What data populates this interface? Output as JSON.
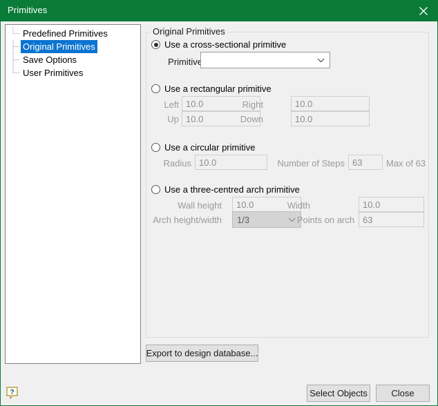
{
  "window": {
    "title": "Primitives",
    "titlebar_color": "#0a7b38",
    "close_icon": "close-icon"
  },
  "sidebar": {
    "items": [
      {
        "label": "Predefined Primitives",
        "selected": false
      },
      {
        "label": "Original Primitives",
        "selected": true
      },
      {
        "label": "Save Options",
        "selected": false
      },
      {
        "label": "User Primitives",
        "selected": false
      }
    ],
    "selection_color": "#0b74d1"
  },
  "main": {
    "group_title": "Original Primitives",
    "options": {
      "cross_sectional": {
        "label": "Use a cross-sectional primitive",
        "selected": true,
        "primitive_label": "Primitive",
        "primitive_value": "",
        "primitive_placeholder": "",
        "dropdown_icon": "chevron-down-icon"
      },
      "rectangular": {
        "label": "Use a rectangular primitive",
        "selected": false,
        "fields": [
          {
            "label": "Left",
            "value": "10.0"
          },
          {
            "label": "Right",
            "value": "10.0"
          },
          {
            "label": "Up",
            "value": "10.0"
          },
          {
            "label": "Down",
            "value": "10.0"
          }
        ]
      },
      "circular": {
        "label": "Use a circular primitive",
        "selected": false,
        "radius_label": "Radius",
        "radius_value": "10.0",
        "steps_label": "Number of Steps",
        "steps_value": "63",
        "steps_note": "Max of 63"
      },
      "arch": {
        "label": "Use a three-centred arch primitive",
        "selected": false,
        "wall_height_label": "Wall height",
        "wall_height_value": "10.0",
        "width_label": "Width",
        "width_value": "10.0",
        "ratio_label": "Arch height/width",
        "ratio_value": "1/3",
        "ratio_icon": "chevron-down-icon",
        "points_label": "Points on arch",
        "points_value": "63"
      }
    },
    "export_button": "Export to design database..."
  },
  "footer": {
    "help_icon": "help-question-icon",
    "select_objects_button": "Select Objects",
    "close_button": "Close"
  }
}
